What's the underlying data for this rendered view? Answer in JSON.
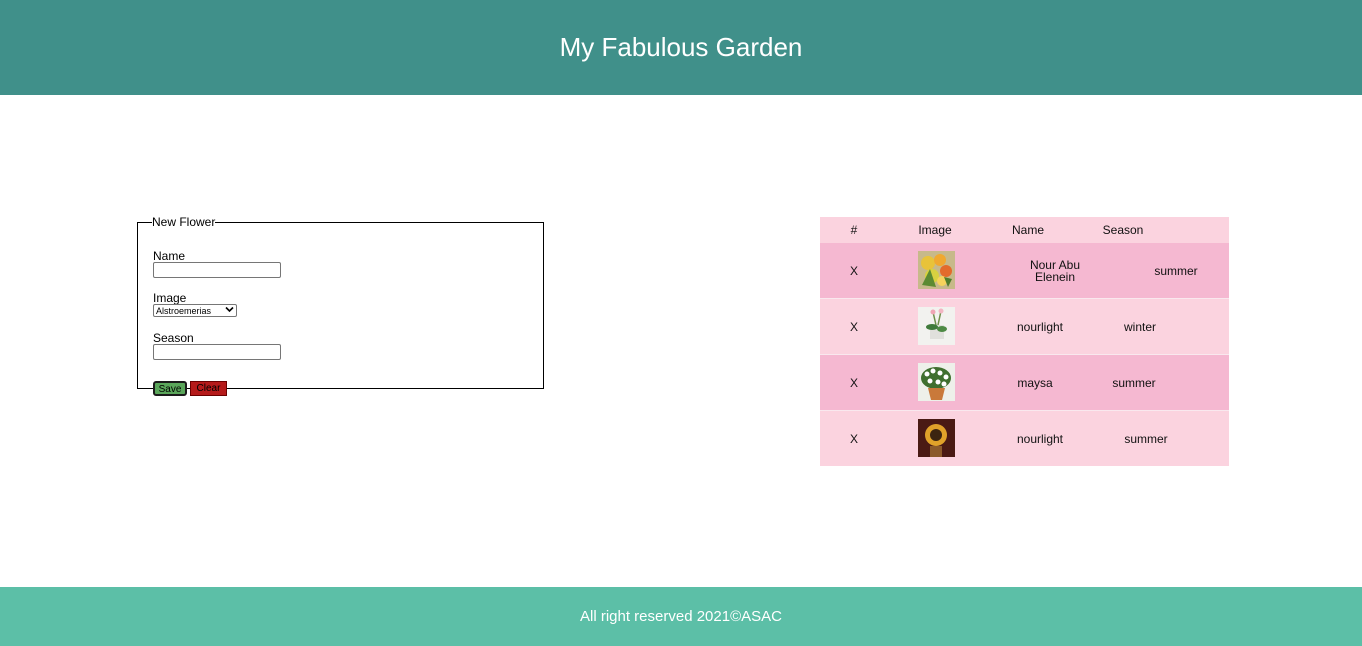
{
  "header": {
    "title": "My Fabulous Garden"
  },
  "form": {
    "legend": "New Flower",
    "name_label": "Name",
    "name_value": "",
    "image_label": "Image",
    "image_selected": "Alstroemerias",
    "season_label": "Season",
    "season_value": "",
    "save_label": "Save",
    "clear_label": "Clear"
  },
  "table": {
    "headers": {
      "num": "#",
      "image": "Image",
      "name": "Name",
      "season": "Season"
    },
    "rows": [
      {
        "delete": "X",
        "name": "Nour Abu Elenein",
        "season": "summer",
        "image_icon": "alstroemeria-bouquet-icon"
      },
      {
        "delete": "X",
        "name": "nourlight",
        "season": "winter",
        "image_icon": "potted-flower-icon"
      },
      {
        "delete": "X",
        "name": "maysa",
        "season": "summer",
        "image_icon": "white-daisy-pot-icon"
      },
      {
        "delete": "X",
        "name": "nourlight",
        "season": "summer",
        "image_icon": "sunflower-icon"
      }
    ]
  },
  "footer": {
    "text": "All right reserved 2021©ASAC"
  },
  "colors": {
    "header_bg": "#40908a",
    "footer_bg": "#5cbfa7",
    "row_light": "#fbd3df",
    "row_dark": "#f5b8d1",
    "save_bg": "#5aa65a",
    "clear_bg": "#b51a1a"
  }
}
